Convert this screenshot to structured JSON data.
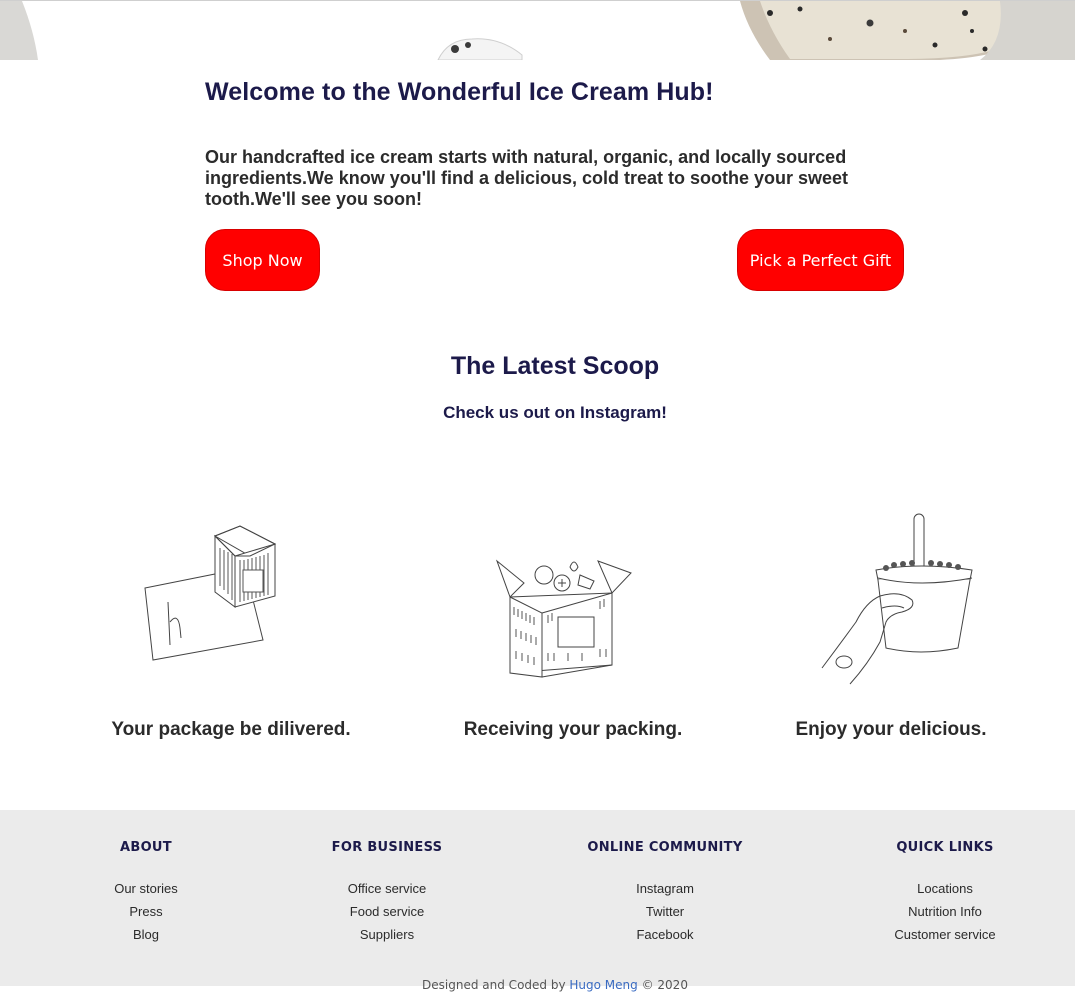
{
  "hero": {
    "image_name": "ice-cream-hero-image"
  },
  "welcome": {
    "title": "Welcome to the Wonderful Ice Cream Hub!",
    "body": "Our handcrafted ice cream starts with natural, organic, and locally sourced ingredients.We know you'll find a delicious, cold treat to soothe your sweet tooth.We'll see you soon!"
  },
  "actions": {
    "shop_label": "Shop Now",
    "gift_label": "Pick a Perfect Gift",
    "button_color": "#ff0000"
  },
  "scoop": {
    "title": "The Latest Scoop",
    "subtitle": "Check us out on Instagram!"
  },
  "steps": [
    {
      "caption": "Your package be dilivered.",
      "icon": "card-and-box-icon"
    },
    {
      "caption": "Receiving your packing.",
      "icon": "open-box-icon"
    },
    {
      "caption": "Enjoy your delicious.",
      "icon": "hand-holding-cup-icon"
    }
  ],
  "footer": {
    "columns": [
      {
        "heading": "ABOUT",
        "links": [
          "Our stories",
          "Press",
          "Blog"
        ]
      },
      {
        "heading": "FOR BUSINESS",
        "links": [
          "Office service",
          "Food service",
          "Suppliers"
        ]
      },
      {
        "heading": "ONLINE COMMUNITY",
        "links": [
          "Instagram",
          "Twitter",
          "Facebook"
        ]
      },
      {
        "heading": "QUICK LINKS",
        "links": [
          "Locations",
          "Nutrition Info",
          "Customer service"
        ]
      }
    ],
    "credit_prefix": "Designed and Coded by",
    "credit_name": "Hugo Meng",
    "credit_suffix": "© 2020",
    "background": "#ebebeb"
  },
  "colors": {
    "heading": "#1c1a4a",
    "text": "#2b2b2b"
  }
}
